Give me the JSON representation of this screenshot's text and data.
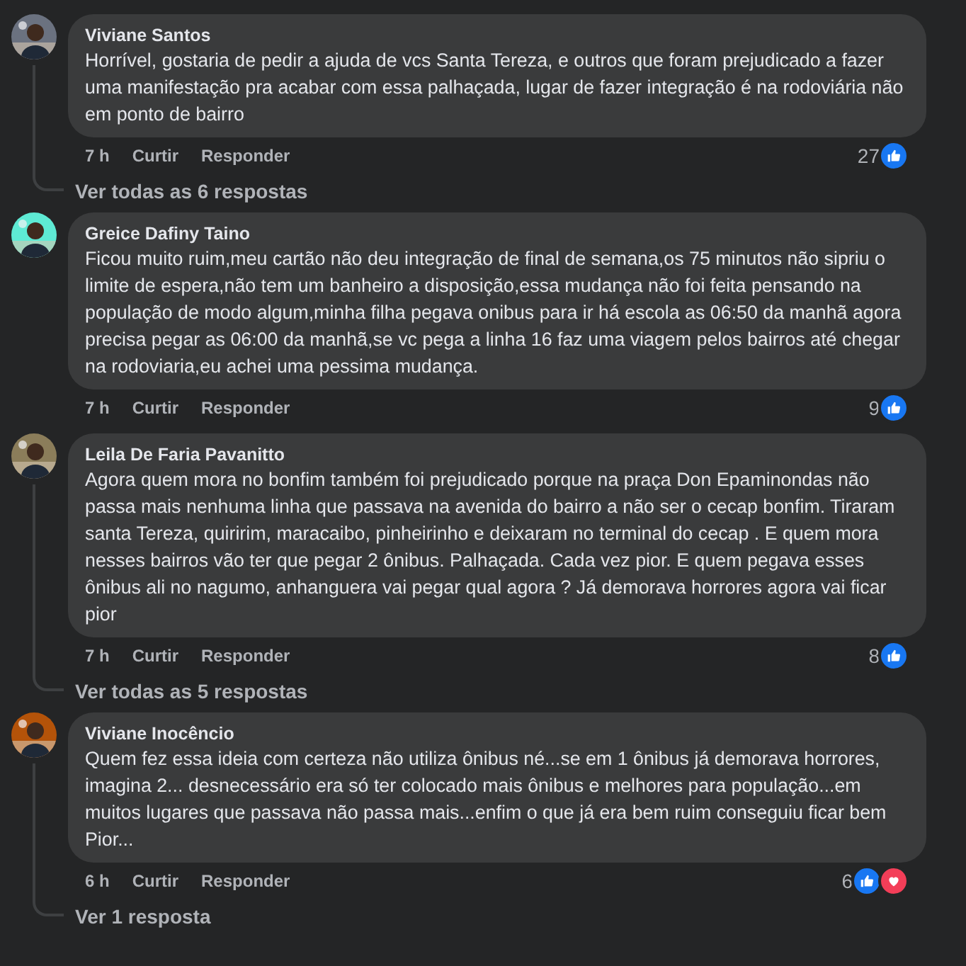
{
  "comments": [
    {
      "author": "Viviane Santos",
      "avatar": {
        "kind": "picture"
      },
      "text": "Horrível, gostaria de pedir a ajuda de vcs Santa Tereza, e outros que foram prejudicado a fazer uma manifestação pra acabar com essa palhaçada, lugar de fazer integração é na rodoviária não em ponto de bairro",
      "time": "7 h",
      "like_label": "Curtir",
      "reply_label": "Responder",
      "reaction_count": "27",
      "reactions": [
        {
          "kind": "like"
        }
      ],
      "replies_link": "Ver todas as 6 respostas"
    },
    {
      "author": "Greice Dafiny Taino",
      "avatar": {
        "kind": "picture"
      },
      "text": "Ficou muito ruim,meu cartão não deu integração de final de semana,os 75 minutos não sipriu o limite de espera,não tem um banheiro a disposição,essa mudança não foi feita pensando na população de modo algum,minha filha pegava onibus para ir há escola as 06:50 da manhã agora precisa pegar as 06:00 da manhã,se vc pega a linha 16 faz uma viagem pelos bairros até chegar na rodoviaria,eu achei uma pessima mudança.",
      "time": "7 h",
      "like_label": "Curtir",
      "reply_label": "Responder",
      "reaction_count": "9",
      "reactions": [
        {
          "kind": "like"
        }
      ]
    },
    {
      "author": "Leila De Faria Pavanitto",
      "avatar": {
        "kind": "picture"
      },
      "text": "Agora quem mora no bonfim também foi prejudicado porque na praça Don Epaminondas não passa mais nenhuma linha que passava na avenida do bairro a não ser o cecap bonfim. Tiraram santa Tereza, quiririm, maracaibo, pinheirinho e deixaram no terminal do cecap . E quem mora nesses bairros vão ter que pegar 2 ônibus. Palhaçada. Cada vez pior. E quem pegava esses ônibus ali no nagumo, anhanguera vai pegar qual agora ? Já demorava horrores agora vai ficar pior",
      "time": "7 h",
      "like_label": "Curtir",
      "reply_label": "Responder",
      "reaction_count": "8",
      "reactions": [
        {
          "kind": "like"
        }
      ],
      "replies_link": "Ver todas as 5 respostas"
    },
    {
      "author": "Viviane Inocêncio",
      "avatar": {
        "kind": "picture"
      },
      "text": "Quem fez essa ideia com certeza não utiliza ônibus né...se em 1 ônibus já demorava horrores, imagina 2... desnecessário era só ter colocado mais ônibus e melhores para população...em muitos lugares que passava não passa mais...enfim o que já era bem ruim conseguiu ficar bem Pior...",
      "time": "6 h",
      "like_label": "Curtir",
      "reply_label": "Responder",
      "reaction_count": "6",
      "reactions": [
        {
          "kind": "like"
        },
        {
          "kind": "love"
        }
      ],
      "replies_link": "Ver 1 resposta"
    }
  ]
}
